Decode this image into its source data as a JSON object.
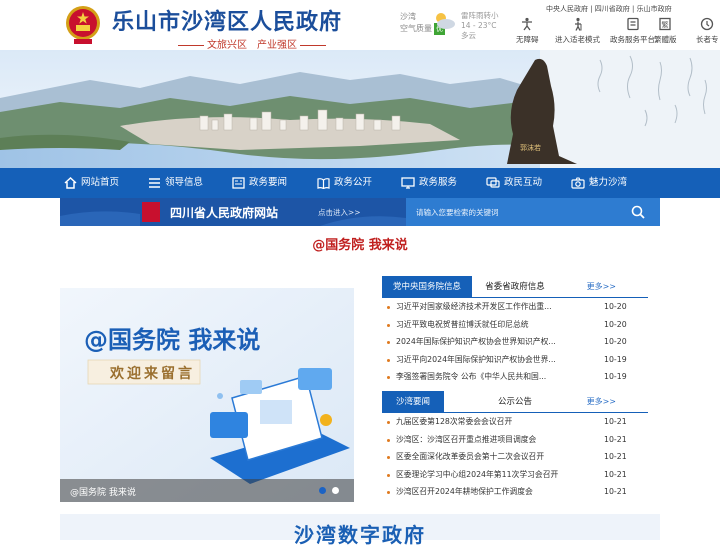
{
  "header": {
    "title": "乐山市沙湾区人民政府",
    "slogan": "文旅兴区　产业强区",
    "weather": {
      "location": "沙湾",
      "air_label": "空气质量",
      "air_value": "优",
      "forecast": "雷阵雨转小",
      "temperature": "14 - 23°C",
      "wind": "多云"
    },
    "top_links": "中央人民政府 | 四川省政府 | 乐山市政府",
    "tools": [
      {
        "label": "无障碍",
        "icon": "accessibility-icon"
      },
      {
        "label": "进入适老模式",
        "icon": "elder-mode-icon"
      },
      {
        "label": "政务服务平台",
        "icon": "service-platform-icon"
      },
      {
        "label": "繁體版",
        "icon": "traditional-chinese-icon"
      },
      {
        "label": "长者专",
        "icon": "elder-area-icon"
      }
    ]
  },
  "nav": [
    {
      "label": "网站首页",
      "icon": "home-icon"
    },
    {
      "label": "领导信息",
      "icon": "list-icon"
    },
    {
      "label": "政务要闻",
      "icon": "news-icon"
    },
    {
      "label": "政务公开",
      "icon": "open-book-icon"
    },
    {
      "label": "政务服务",
      "icon": "monitor-icon"
    },
    {
      "label": "政民互动",
      "icon": "chat-icon"
    },
    {
      "label": "魅力沙湾",
      "icon": "camera-icon"
    }
  ],
  "province_link": {
    "title": "四川省人民政府网站",
    "enter": "点击进入>>"
  },
  "search": {
    "placeholder": "请输入您要检索的关键词"
  },
  "gwy_heading": "@国务院 我来说",
  "feature": {
    "title": "@国务院 我来说",
    "subtitle": "欢迎来留言",
    "caption": "@国务院 我来说"
  },
  "panel1": {
    "tabs": [
      "党中央国务院信息",
      "省委省政府信息"
    ],
    "more": "更多>>",
    "items": [
      {
        "title": "习近平对国家级经济技术开发区工作作出重...",
        "date": "10-20"
      },
      {
        "title": "习近平致电祝贺普拉博沃就任印尼总统",
        "date": "10-20"
      },
      {
        "title": "2024年国际保护知识产权协会世界知识产权...",
        "date": "10-20"
      },
      {
        "title": "习近平向2024年国际保护知识产权协会世界...",
        "date": "10-19"
      },
      {
        "title": "李强签署国务院令 公布《中华人民共和国...",
        "date": "10-19"
      }
    ]
  },
  "panel2": {
    "tabs": [
      "沙湾要闻",
      "公示公告"
    ],
    "more": "更多>>",
    "items": [
      {
        "title": "九届区委第128次常委会会议召开",
        "date": "10-21"
      },
      {
        "title": "沙湾区：沙湾区召开重点推进项目调度会",
        "date": "10-21"
      },
      {
        "title": "区委全面深化改革委员会第十二次会议召开",
        "date": "10-21"
      },
      {
        "title": "区委理论学习中心组2024年第11次学习会召开",
        "date": "10-21"
      },
      {
        "title": "沙湾区召开2024年耕地保护工作调度会",
        "date": "10-21"
      }
    ]
  },
  "digital_title": "沙湾数字政府",
  "colors": {
    "primary": "#1560b8",
    "title_blue": "#1b4e9b",
    "accent_red": "#c0201f"
  }
}
